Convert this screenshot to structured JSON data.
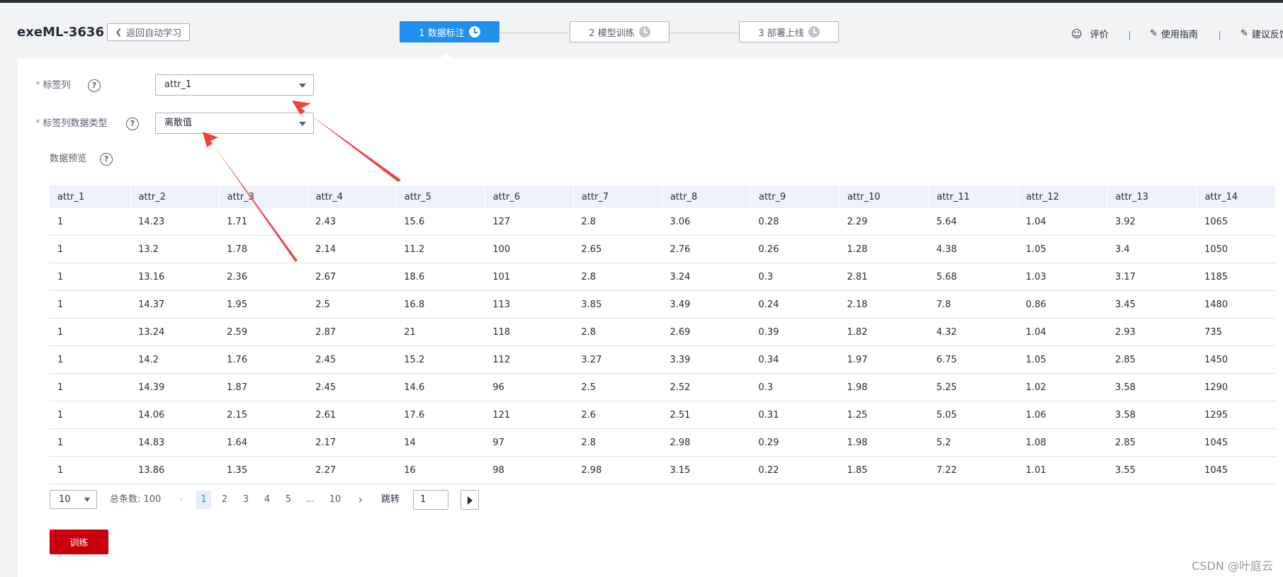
{
  "header": {
    "title": "exeML-3636",
    "back_label": "返回自动学习",
    "steps": [
      {
        "label": "1 数据标注",
        "active": true
      },
      {
        "label": "2 模型训练",
        "active": false
      },
      {
        "label": "3 部署上线",
        "active": false
      }
    ],
    "links": {
      "rate": "评价",
      "guide": "使用指南",
      "feedback": "建议反馈"
    }
  },
  "form": {
    "label_column": {
      "label": "标签列",
      "value": "attr_1"
    },
    "label_type": {
      "label": "标签列数据类型",
      "value": "离散值"
    },
    "preview_label": "数据预览"
  },
  "table": {
    "columns": [
      "attr_1",
      "attr_2",
      "attr_3",
      "attr_4",
      "attr_5",
      "attr_6",
      "attr_7",
      "attr_8",
      "attr_9",
      "attr_10",
      "attr_11",
      "attr_12",
      "attr_13",
      "attr_14"
    ],
    "rows": [
      [
        "1",
        "14.23",
        "1.71",
        "2.43",
        "15.6",
        "127",
        "2.8",
        "3.06",
        "0.28",
        "2.29",
        "5.64",
        "1.04",
        "3.92",
        "1065"
      ],
      [
        "1",
        "13.2",
        "1.78",
        "2.14",
        "11.2",
        "100",
        "2.65",
        "2.76",
        "0.26",
        "1.28",
        "4.38",
        "1.05",
        "3.4",
        "1050"
      ],
      [
        "1",
        "13.16",
        "2.36",
        "2.67",
        "18.6",
        "101",
        "2.8",
        "3.24",
        "0.3",
        "2.81",
        "5.68",
        "1.03",
        "3.17",
        "1185"
      ],
      [
        "1",
        "14.37",
        "1.95",
        "2.5",
        "16.8",
        "113",
        "3.85",
        "3.49",
        "0.24",
        "2.18",
        "7.8",
        "0.86",
        "3.45",
        "1480"
      ],
      [
        "1",
        "13.24",
        "2.59",
        "2.87",
        "21",
        "118",
        "2.8",
        "2.69",
        "0.39",
        "1.82",
        "4.32",
        "1.04",
        "2.93",
        "735"
      ],
      [
        "1",
        "14.2",
        "1.76",
        "2.45",
        "15.2",
        "112",
        "3.27",
        "3.39",
        "0.34",
        "1.97",
        "6.75",
        "1.05",
        "2.85",
        "1450"
      ],
      [
        "1",
        "14.39",
        "1.87",
        "2.45",
        "14.6",
        "96",
        "2.5",
        "2.52",
        "0.3",
        "1.98",
        "5.25",
        "1.02",
        "3.58",
        "1290"
      ],
      [
        "1",
        "14.06",
        "2.15",
        "2.61",
        "17.6",
        "121",
        "2.6",
        "2.51",
        "0.31",
        "1.25",
        "5.05",
        "1.06",
        "3.58",
        "1295"
      ],
      [
        "1",
        "14.83",
        "1.64",
        "2.17",
        "14",
        "97",
        "2.8",
        "2.98",
        "0.29",
        "1.98",
        "5.2",
        "1.08",
        "2.85",
        "1045"
      ],
      [
        "1",
        "13.86",
        "1.35",
        "2.27",
        "16",
        "98",
        "2.98",
        "3.15",
        "0.22",
        "1.85",
        "7.22",
        "1.01",
        "3.55",
        "1045"
      ]
    ]
  },
  "pagination": {
    "page_size": "10",
    "total_label": "总条数: 100",
    "pages": [
      "1",
      "2",
      "3",
      "4",
      "5",
      "...",
      "10"
    ],
    "current": "1",
    "jump_label": "跳转",
    "jump_value": "1"
  },
  "actions": {
    "train_label": "训练"
  },
  "watermark": "CSDN @叶庭云",
  "colors": {
    "primary": "#1f8ff0",
    "danger": "#c7000b",
    "annotation": "#f0413e"
  }
}
